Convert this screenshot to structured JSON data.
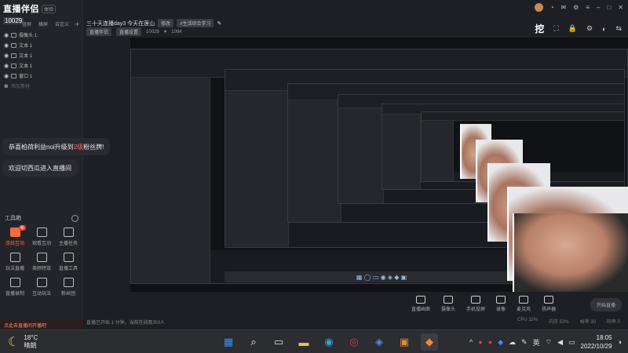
{
  "app": {
    "logo": "直播伴侣",
    "logo_badge": "体验",
    "room_id": "10029",
    "scene_tabs": [
      "竖屏",
      "横屏",
      "自定义"
    ],
    "add_scene": "+",
    "layers": [
      {
        "label": "摄像头 1"
      },
      {
        "label": "文本 1"
      },
      {
        "label": "文本 1"
      },
      {
        "label": "文本 1"
      },
      {
        "label": "窗口 1"
      },
      {
        "label": "添加素材"
      }
    ]
  },
  "danmu": [
    {
      "pre": "恭喜柏荷利益noi升级到",
      "hl": "2级",
      "post": "粉丝牌!"
    },
    {
      "pre": "欢迎切西瓜进入直播间",
      "hl": "",
      "post": ""
    }
  ],
  "tools": {
    "title": "工具箱",
    "items": [
      {
        "label": "连线互动",
        "hot": true,
        "badge": "新"
      },
      {
        "label": "观看互动",
        "hot": false,
        "badge": ""
      },
      {
        "label": "主播任务",
        "hot": false,
        "badge": ""
      },
      {
        "label": "玩法直播",
        "hot": false,
        "badge": ""
      },
      {
        "label": "美颜特效",
        "hot": false,
        "badge": ""
      },
      {
        "label": "直播工具",
        "hot": false,
        "badge": ""
      },
      {
        "label": "直播录制",
        "hot": false,
        "badge": ""
      },
      {
        "label": "互动玩法",
        "hot": false,
        "badge": ""
      },
      {
        "label": "粉丝团",
        "hot": false,
        "badge": ""
      }
    ],
    "bottom_note": "点此去直播间开播吧"
  },
  "header": {
    "title": "三十天连播day3 今天在莲山",
    "edit": "修改",
    "category": "#生活综合学习",
    "tag1": "直播伴侣",
    "tag2": "直播设置",
    "views": "10029",
    "likes": "1094",
    "icons": [
      "avatar",
      "settings",
      "minimize",
      "maximize",
      "close"
    ],
    "right_tools": [
      "挖",
      "⛶",
      "🔒",
      "⚙",
      "◐",
      "⇆"
    ]
  },
  "dock": {
    "items": [
      "直播画面",
      "摄像头",
      "手机投屏",
      "录像",
      "麦克风",
      "扬声器"
    ],
    "start_live": "开始直播"
  },
  "status": {
    "left": "直播已开始 1 分钟，当前在线观众0人",
    "right": [
      "CPU 11%",
      "内存 52%",
      "帧率 30",
      "码率 0"
    ]
  },
  "taskbar": {
    "temp": "18°C",
    "weather": "晴朗",
    "time": "18:05",
    "date": "2022/10/29",
    "lang": "英"
  }
}
